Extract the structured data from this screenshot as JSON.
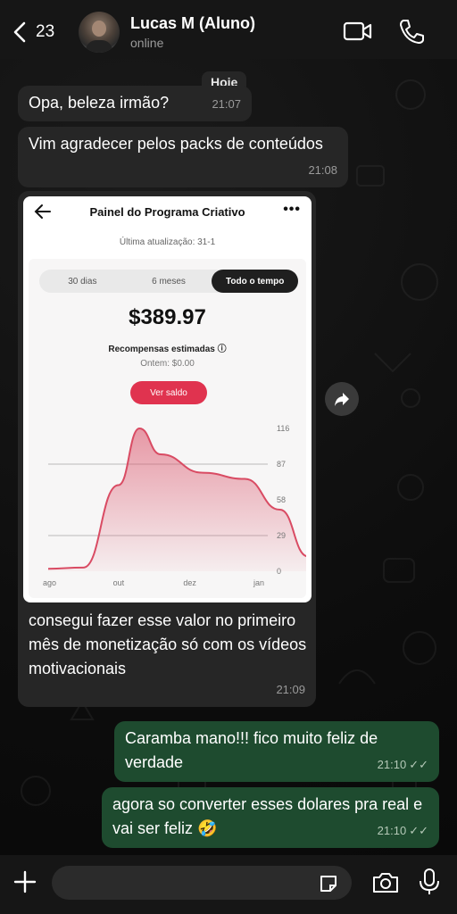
{
  "header": {
    "back_count": "23",
    "contact_name": "Lucas M (Aluno)",
    "status": "online"
  },
  "date_label": "Hoje",
  "messages": [
    {
      "text": "Opa, beleza irmão?",
      "time": "21:07",
      "direction": "in"
    },
    {
      "text": "Vim agradecer pelos packs de conteúdos",
      "time": "21:08",
      "direction": "in"
    },
    {
      "text": "consegui fazer esse valor no primeiro mês de monetização só com os vídeos motivacionais",
      "time": "21:09",
      "direction": "in"
    },
    {
      "text": "Caramba mano!!! fico muito feliz de verdade",
      "time": "21:10",
      "direction": "out"
    },
    {
      "text": "agora so converter esses dolares pra real e vai ser feliz 🤣",
      "time": "21:10",
      "direction": "out"
    }
  ],
  "screenshot": {
    "title": "Painel do Programa Criativo",
    "updated": "Última atualização: 31-1",
    "tabs": [
      "30 dias",
      "6 meses",
      "Todo o tempo"
    ],
    "active_tab": "Todo o tempo",
    "amount": "$389.97",
    "rewards_label": "Recompensas estimadas ⓘ",
    "yesterday": "Ontem: $0.00",
    "button": "Ver saldo",
    "chart_data": {
      "type": "area",
      "x": [
        "ago",
        "out",
        "dez",
        "jan"
      ],
      "yticks": [
        116,
        87,
        58,
        29,
        0
      ],
      "ylim": [
        0,
        116
      ],
      "points": [
        [
          0,
          2
        ],
        [
          0.5,
          3
        ],
        [
          1,
          70
        ],
        [
          1.3,
          116
        ],
        [
          1.6,
          95
        ],
        [
          2.2,
          80
        ],
        [
          2.8,
          75
        ],
        [
          3.3,
          50
        ],
        [
          3.7,
          12
        ]
      ],
      "color": "#d94b63"
    }
  },
  "composer": {
    "placeholder": ""
  },
  "colors": {
    "incoming": "#262626",
    "outgoing": "#1e4b2f",
    "accent": "#e0334f"
  }
}
